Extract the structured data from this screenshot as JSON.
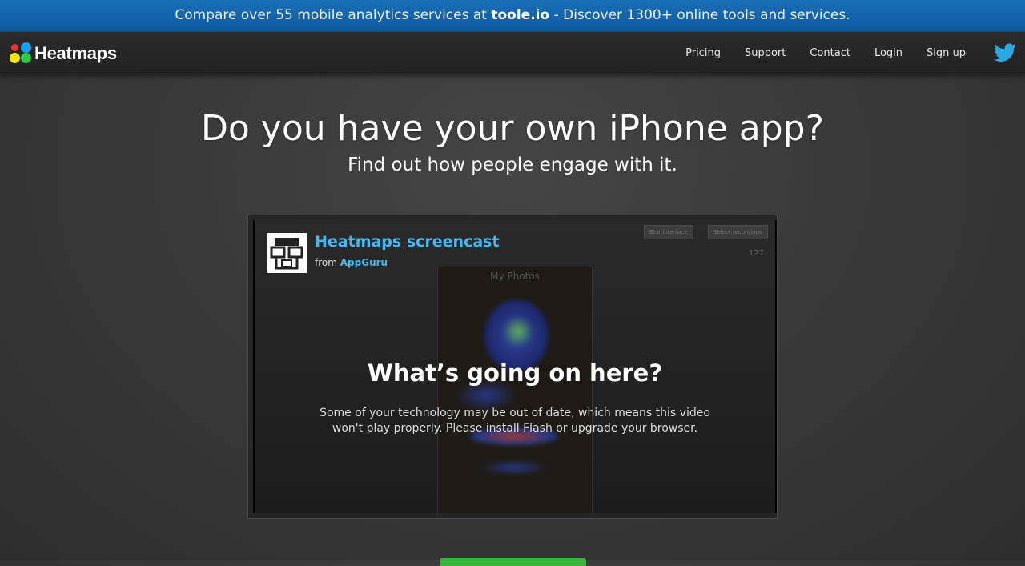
{
  "promo": {
    "text_before": "Compare over 55 mobile analytics services at ",
    "link": "toole.io",
    "text_after": " - Discover 1300+ online tools and services."
  },
  "nav": {
    "logo_text": "Heatmaps",
    "links": [
      "Pricing",
      "Support",
      "Contact",
      "Login",
      "Sign up"
    ],
    "twitter_icon": "twitter-icon"
  },
  "hero": {
    "headline": "Do you have your own iPhone app?",
    "subline": "Find out how people engage with it."
  },
  "video": {
    "title": "Heatmaps screencast",
    "from_label": "from",
    "author": "AppGuru",
    "overlay_title": "What’s going on here?",
    "overlay_message": "Some of your technology may be out of date, which means this video won't play properly. Please install Flash or upgrade your browser.",
    "still": {
      "phone_title": "My Photos",
      "toolbar_left": "Blur interface",
      "toolbar_right": "Select recordings",
      "counter": "127"
    }
  },
  "colors": {
    "promo_bg": "#0d5a9f",
    "link_blue": "#44b8f2",
    "cta_green": "#3bb53b"
  }
}
